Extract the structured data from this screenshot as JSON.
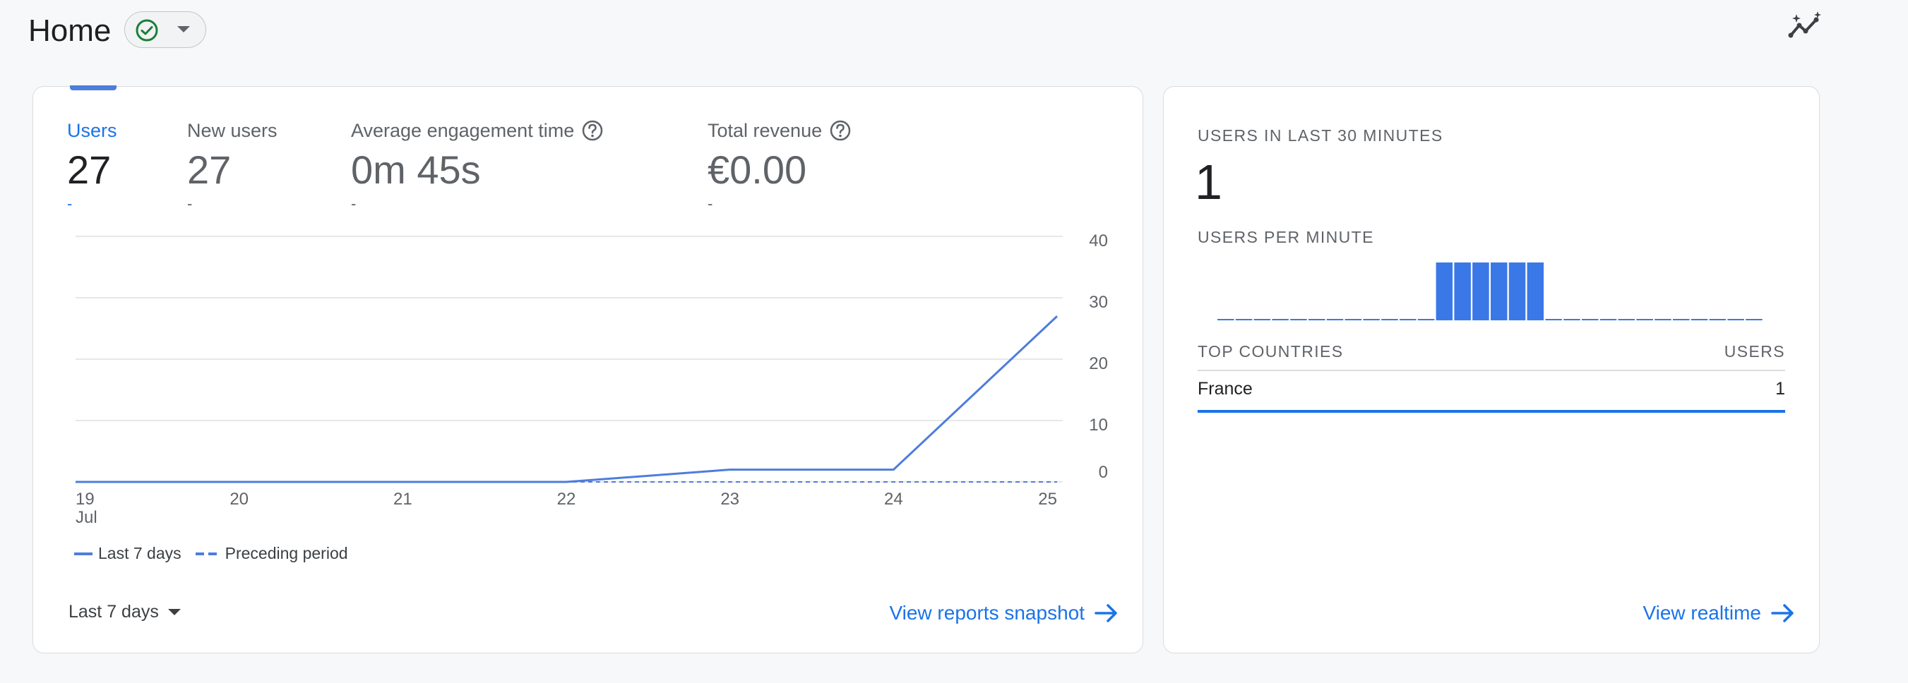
{
  "header": {
    "title": "Home",
    "status_icon": "check-circle-icon",
    "dropdown_icon": "caret-down-icon",
    "insights_icon": "insights-sparkle-icon"
  },
  "overview": {
    "metrics": [
      {
        "label": "Users",
        "value": "27",
        "delta": "-",
        "active": true,
        "help": false
      },
      {
        "label": "New users",
        "value": "27",
        "delta": "-",
        "active": false,
        "help": false
      },
      {
        "label": "Average engagement time",
        "value": "0m 45s",
        "delta": "-",
        "active": false,
        "help": true
      },
      {
        "label": "Total revenue",
        "value": "€0.00",
        "delta": "-",
        "active": false,
        "help": true
      }
    ],
    "legend": {
      "current": "Last 7 days",
      "previous": "Preceding period"
    },
    "range_label": "Last 7 days",
    "snapshot_link": "View reports snapshot"
  },
  "chart_data": {
    "type": "line",
    "x": [
      "19",
      "20",
      "21",
      "22",
      "23",
      "24",
      "25"
    ],
    "x_sublabel": {
      "19": "Jul"
    },
    "yticks": [
      0,
      10,
      20,
      30,
      40
    ],
    "ylim": [
      0,
      40
    ],
    "series": [
      {
        "name": "Last 7 days",
        "values": [
          0,
          0,
          0,
          0,
          2,
          2,
          27
        ],
        "style": "solid"
      },
      {
        "name": "Preceding period",
        "values": [
          0,
          0,
          0,
          0,
          0,
          0,
          0
        ],
        "style": "dashed"
      }
    ],
    "color": "#4e7ddb",
    "legend": "bottom-left",
    "grid": true
  },
  "realtime": {
    "users_label": "USERS IN LAST 30 MINUTES",
    "users_value": "1",
    "per_minute_label": "USERS PER MINUTE",
    "per_minute": [
      0,
      0,
      0,
      0,
      0,
      0,
      0,
      0,
      0,
      0,
      0,
      0,
      1,
      1,
      1,
      1,
      1,
      1,
      0,
      0,
      0,
      0,
      0,
      0,
      0,
      0,
      0,
      0,
      0,
      0
    ],
    "countries_header": "TOP COUNTRIES",
    "users_header": "USERS",
    "countries": [
      {
        "name": "France",
        "users": "1"
      }
    ],
    "realtime_link": "View realtime"
  },
  "colors": {
    "accent": "#1a73e8",
    "line": "#4e7ddb",
    "success": "#188038"
  }
}
